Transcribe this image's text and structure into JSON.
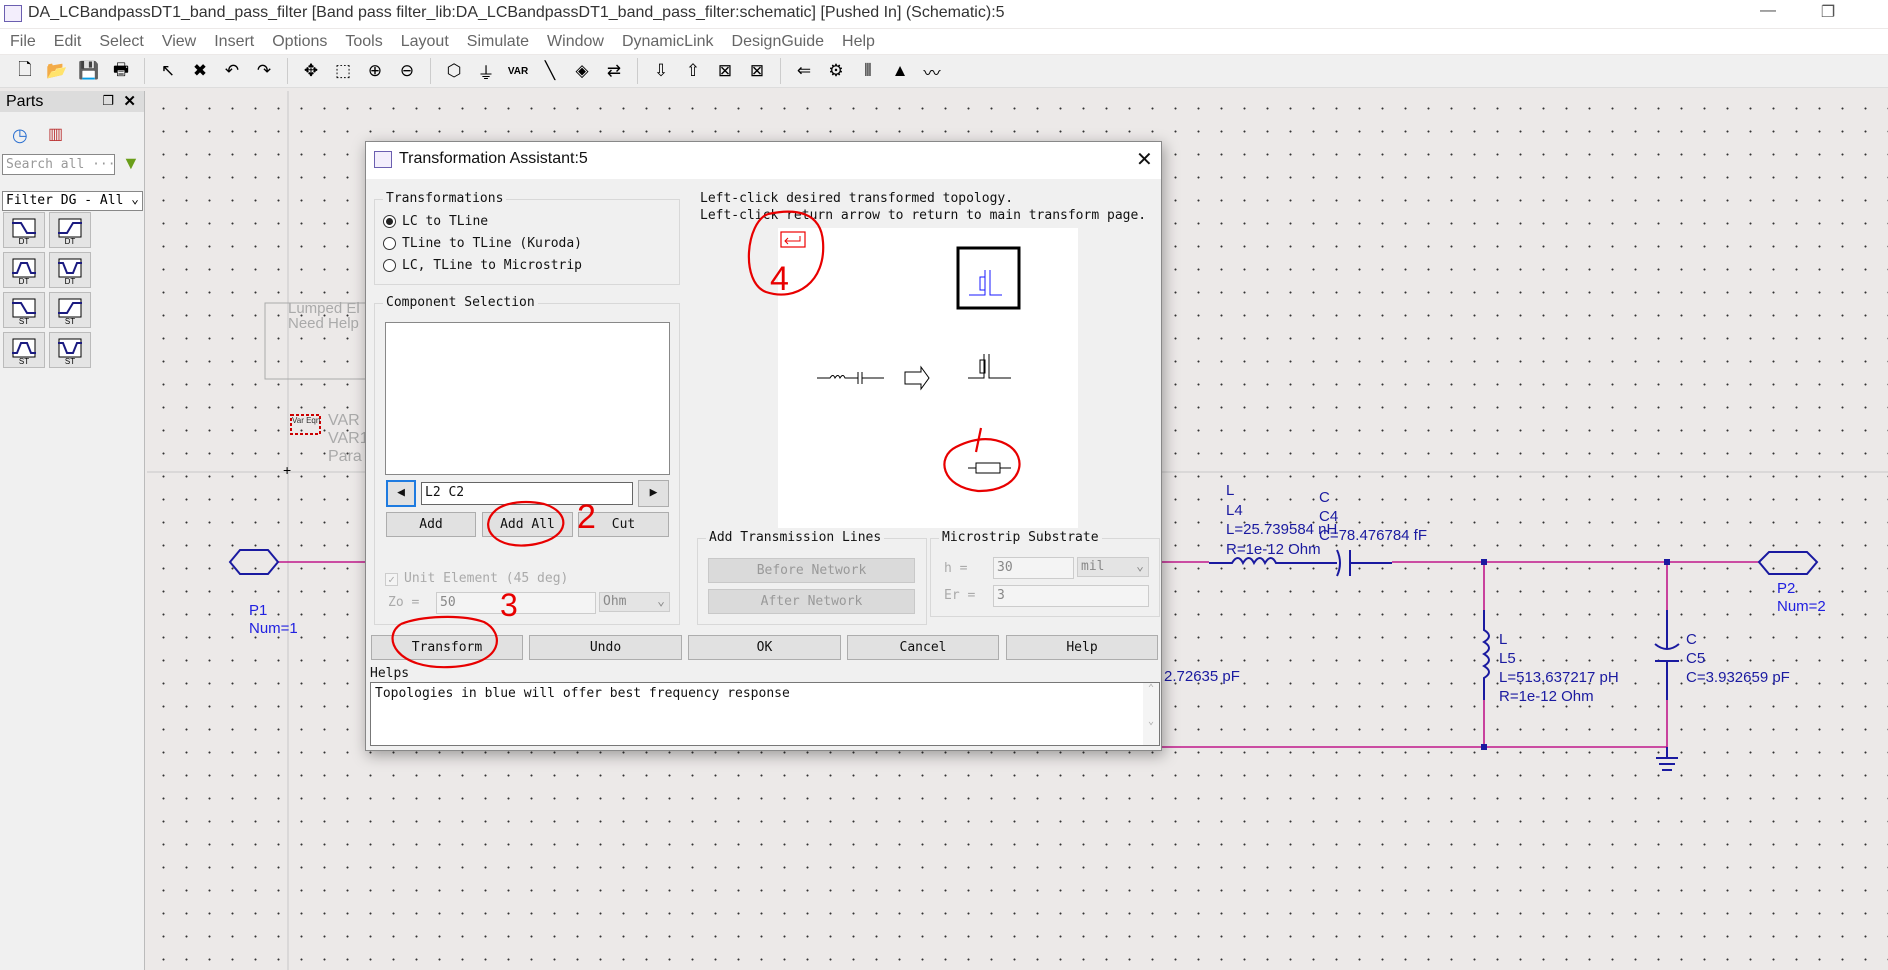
{
  "window": {
    "title": "DA_LCBandpassDT1_band_pass_filter [Band pass filter_lib:DA_LCBandpassDT1_band_pass_filter:schematic] [Pushed In] (Schematic):5",
    "minimize": "—",
    "restore": "❐"
  },
  "menu": [
    "File",
    "Edit",
    "Select",
    "View",
    "Insert",
    "Options",
    "Tools",
    "Layout",
    "Simulate",
    "Window",
    "DynamicLink",
    "DesignGuide",
    "Help"
  ],
  "toolbar": [
    {
      "icon": "new-file-icon",
      "glyph": "🗋"
    },
    {
      "icon": "open-folder-icon",
      "glyph": "📂"
    },
    {
      "icon": "save-icon",
      "glyph": "💾"
    },
    {
      "icon": "print-icon",
      "glyph": "🖶"
    },
    {
      "icon": "select-pointer-icon",
      "glyph": "↖"
    },
    {
      "icon": "delete-icon",
      "glyph": "✖"
    },
    {
      "icon": "undo-icon",
      "glyph": "↶"
    },
    {
      "icon": "redo-icon",
      "glyph": "↷"
    },
    {
      "icon": "move-icon",
      "glyph": "✥"
    },
    {
      "icon": "zoom-area-icon",
      "glyph": "⬚"
    },
    {
      "icon": "zoom-in-icon",
      "glyph": "⊕"
    },
    {
      "icon": "zoom-out-icon",
      "glyph": "⊖"
    },
    {
      "icon": "port-icon",
      "glyph": "⬡"
    },
    {
      "icon": "ground-icon",
      "glyph": "⏚"
    },
    {
      "icon": "var-icon",
      "glyph": "VAR"
    },
    {
      "icon": "wire-icon",
      "glyph": "╲"
    },
    {
      "icon": "name-icon",
      "glyph": "◈"
    },
    {
      "icon": "swap-icon",
      "glyph": "⇄"
    },
    {
      "icon": "push-into-icon",
      "glyph": "⇩"
    },
    {
      "icon": "pop-out-icon",
      "glyph": "⇧"
    },
    {
      "icon": "deactivate-icon",
      "glyph": "⊠"
    },
    {
      "icon": "short-icon",
      "glyph": "⊠"
    },
    {
      "icon": "design-guide-icon",
      "glyph": "⇐"
    },
    {
      "icon": "tuning-icon",
      "glyph": "⚙"
    },
    {
      "icon": "tune-icon",
      "glyph": "⫴"
    },
    {
      "icon": "simulate-icon",
      "glyph": "▲"
    },
    {
      "icon": "display-icon",
      "glyph": "〰"
    }
  ],
  "parts": {
    "title": "Parts",
    "search_placeholder": "Search all ···",
    "library": "Filter DG - All",
    "items": [
      {
        "label": "DT",
        "shape": "lowpass"
      },
      {
        "label": "DT",
        "shape": "highpass"
      },
      {
        "label": "DT",
        "shape": "bandpass"
      },
      {
        "label": "DT",
        "shape": "bandstop"
      },
      {
        "label": "ST",
        "shape": "lowpass"
      },
      {
        "label": "ST",
        "shape": "highpass"
      },
      {
        "label": "ST",
        "shape": "bandpass"
      },
      {
        "label": "ST",
        "shape": "bandstop"
      }
    ]
  },
  "schematic": {
    "note": [
      "Lumped El",
      "Need Help"
    ],
    "var": {
      "icon": "Var Eqn",
      "lines": [
        "VAR",
        "VAR1",
        "Para"
      ]
    },
    "p1": [
      "P1",
      "Num=1"
    ],
    "p2": [
      "P2",
      "Num=2"
    ],
    "l4": [
      "L",
      "L4",
      "L=25.739584 nH",
      "R=1e-12 Ohm"
    ],
    "c4": [
      "C",
      "C4",
      "C=78.476784 fF"
    ],
    "l5": [
      "L",
      "L5",
      "L=513.637217 pH",
      "R=1e-12 Ohm"
    ],
    "c5": [
      "C",
      "C5",
      "C=3.932659 pF"
    ],
    "partial": "2.72635 pF",
    "colors": {
      "wire": "#c0188a",
      "component": "#1a1aa0",
      "label_type": "#2f8fe8"
    }
  },
  "dialog": {
    "title": "Transformation Assistant:5",
    "transformations": {
      "legend": "Transformations",
      "options": [
        "LC to TLine",
        "TLine to TLine (Kuroda)",
        "LC, TLine to Microstrip"
      ],
      "selected": 0
    },
    "component_selection": {
      "legend": "Component Selection",
      "current": "L2 C2",
      "add": "Add",
      "add_all": "Add All",
      "cut": "Cut"
    },
    "unit_element": {
      "label": "Unit Element (45 deg)",
      "checked": true
    },
    "zo": {
      "label": "Zo =",
      "value": "50",
      "unit": "Ohm"
    },
    "instructions": [
      "Left-click desired transformed topology.",
      "Left-click return arrow to return to main transform page."
    ],
    "tlines": {
      "legend": "Add Transmission Lines",
      "before": "Before Network",
      "after": "After Network"
    },
    "substrate": {
      "legend": "Microstrip Substrate",
      "h_label": "h =",
      "h_value": "30",
      "h_unit": "mil",
      "er_label": "Er =",
      "er_value": "3"
    },
    "buttons": {
      "transform": "Transform",
      "undo": "Undo",
      "ok": "OK",
      "cancel": "Cancel",
      "help": "Help"
    },
    "helps": {
      "label": "Helps",
      "text": "Topologies in blue will offer best frequency response"
    },
    "annotations": [
      "4",
      "1",
      "2",
      "3"
    ]
  }
}
